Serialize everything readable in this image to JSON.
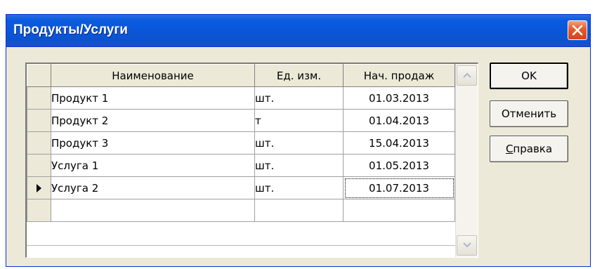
{
  "window": {
    "title": "Продукты/Услуги",
    "accent": "#0a55d6",
    "close_color": "#e45a2b"
  },
  "grid": {
    "columns": [
      "Наименование",
      "Ед. изм.",
      "Нач. продаж"
    ],
    "rows": [
      {
        "name": "Продукт 1",
        "unit": "шт.",
        "start": "01.03.2013"
      },
      {
        "name": "Продукт 2",
        "unit": "т",
        "start": "01.04.2013"
      },
      {
        "name": "Продукт 3",
        "unit": "шт.",
        "start": "15.04.2013"
      },
      {
        "name": "Услуга 1",
        "unit": "шт.",
        "start": "01.05.2013"
      },
      {
        "name": "Услуга 2",
        "unit": "шт.",
        "start": "01.07.2013",
        "current": true
      }
    ]
  },
  "buttons": {
    "ok": "OK",
    "cancel": "Отменить",
    "help_accel": "С",
    "help_rest": "правка"
  },
  "icons": {
    "close": "close-icon",
    "row_pointer": "row-pointer-icon",
    "scroll_up": "scroll-up-icon",
    "scroll_down": "scroll-down-icon"
  }
}
